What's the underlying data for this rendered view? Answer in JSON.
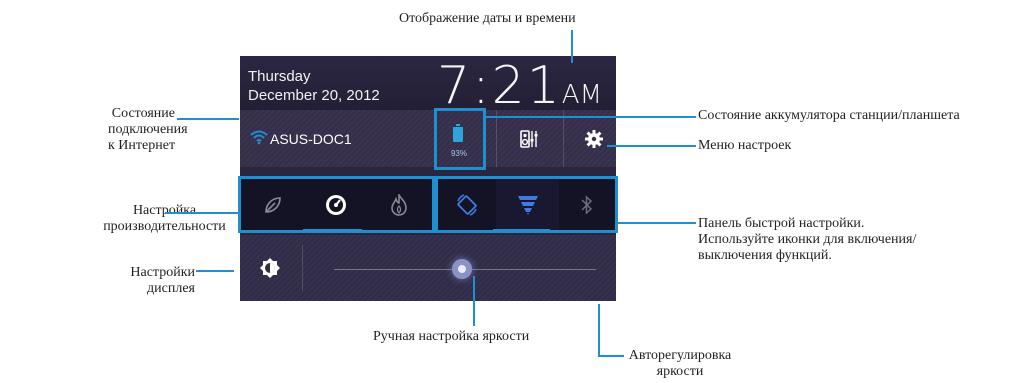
{
  "callouts": {
    "datetime": "Отображение даты и времени",
    "internet_1": "Состояние",
    "internet_2": "подключения",
    "internet_3": "к Интернет",
    "battery": "Состояние аккумулятора станции/планшета",
    "settings_menu": "Меню настроек",
    "performance_1": "Настройка",
    "performance_2": "производительности",
    "quick_1": "Панель быстрой настройки.",
    "quick_2": "Используйте иконки для включения/",
    "quick_3": "выключения функций.",
    "display_1": "Настройки",
    "display_2": "дисплея",
    "manual_brightness": "Ручная настройка яркости",
    "auto_1": "Авторегулировка",
    "auto_2": "яркости"
  },
  "panel": {
    "day": "Thursday",
    "date": "December 20, 2012",
    "time": "7:21",
    "ampm": "AM",
    "wifi_name": "ASUS-DOC1",
    "battery_percent": "93%",
    "battery_level": 0.93,
    "brightness_level": 0.49
  },
  "icons": {
    "wifi": "wifi-icon",
    "battery": "battery-icon",
    "audio": "audio-settings-icon",
    "settings": "gear-icon",
    "power_saving": "leaf-icon",
    "balanced": "gauge-icon",
    "performance": "flame-icon",
    "rotation": "screen-rotation-icon",
    "wifi_toggle": "wifi-toggle-icon",
    "bluetooth": "bluetooth-icon",
    "brightness": "brightness-icon"
  },
  "colors": {
    "accent": "#1e8fd0",
    "panel_bg": "#2f2a40",
    "active_icon": "#3d7de0"
  }
}
